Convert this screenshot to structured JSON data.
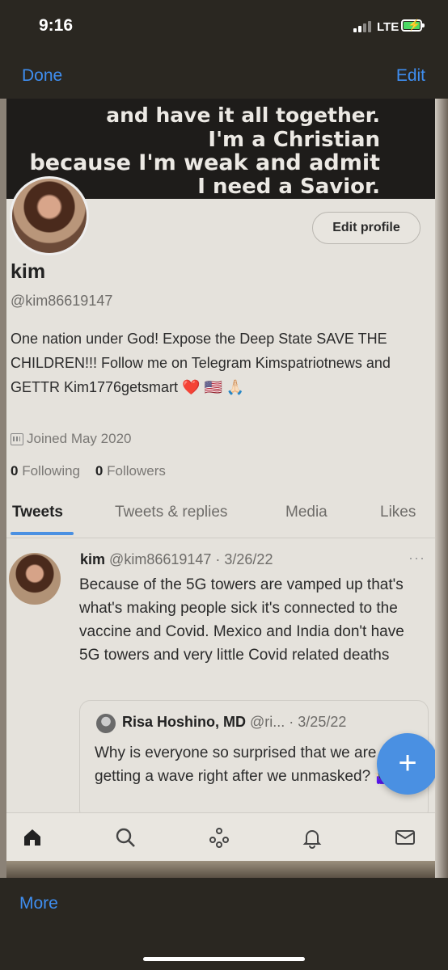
{
  "status_bar": {
    "time": "9:16",
    "network": "LTE"
  },
  "nav": {
    "done": "Done",
    "edit": "Edit"
  },
  "banner": {
    "lines": [
      "and have it all together.",
      "I'm a Christian",
      "because I'm weak and admit",
      "I need a Savior."
    ]
  },
  "profile": {
    "edit_button": "Edit profile",
    "name": "kim",
    "handle": "@kim86619147",
    "bio": "One nation under God! Expose the Deep State SAVE THE CHILDREN!!! Follow me on Telegram Kimspatriotnews and GETTR Kim1776getsmart ❤️ 🇺🇸 🙏🏻",
    "joined": "Joined May 2020",
    "following_count": "0",
    "following_label": "Following",
    "followers_count": "0",
    "followers_label": "Followers"
  },
  "tabs": [
    "Tweets",
    "Tweets & replies",
    "Media",
    "Likes"
  ],
  "tweet": {
    "name": "kim",
    "meta": "@kim86619147 · 3/26/22",
    "more": "···",
    "text": "Because of the 5G towers are vamped up that's what's making people sick it's connected to the vaccine and Covid. Mexico and India don't have 5G towers and very little Covid related deaths",
    "quote": {
      "name": "Risa Hoshino, MD",
      "meta": "@ri... · 3/25/22",
      "text": "Why is everyone so surprised that we are getting a wave right after we unmasked? 🤷🏻‍♀️"
    }
  },
  "fab": "+",
  "bottom_nav": [
    "home-icon",
    "search-icon",
    "spaces-icon",
    "notifications-icon",
    "messages-icon"
  ],
  "toolbar": {
    "more": "More"
  },
  "colors": {
    "accent": "#4a90e2",
    "ios_blue": "#3f8ef0"
  }
}
